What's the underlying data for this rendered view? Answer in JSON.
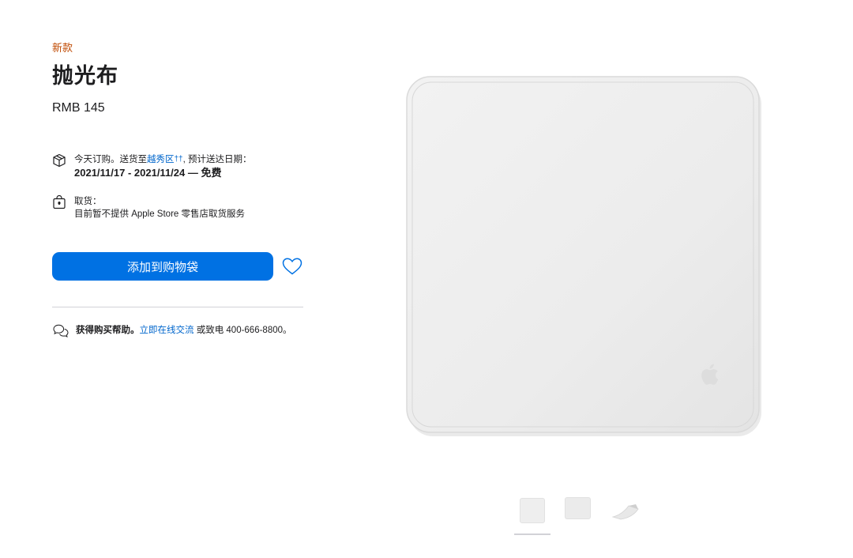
{
  "product": {
    "badge": "新款",
    "title": "抛光布",
    "price": "RMB 145"
  },
  "delivery": {
    "icon": "box-icon",
    "prefix": "今天订购。送货至",
    "location": "越秀区",
    "location_mark": "††",
    "suffix": ", 预计送达日期：",
    "dates": "2021/11/17 - 2021/11/24 — 免费"
  },
  "pickup": {
    "icon": "shopping-bag-icon",
    "label": "取货：",
    "info": "目前暂不提供 Apple Store 零售店取货服务"
  },
  "actions": {
    "add_to_bag": "添加到购物袋",
    "favorite_icon": "heart-icon"
  },
  "help": {
    "icon": "chat-bubbles-icon",
    "strong": "获得购买帮助。",
    "link": "立即在线交流",
    "phone": "或致电 400-666-8800。"
  },
  "gallery": {
    "thumbnails": [
      "cloth-front",
      "cloth-flat",
      "cloth-folded"
    ],
    "selected_index": 0
  },
  "colors": {
    "badge": "#bf4800",
    "accent": "#0071e3",
    "link": "#0066cc"
  }
}
